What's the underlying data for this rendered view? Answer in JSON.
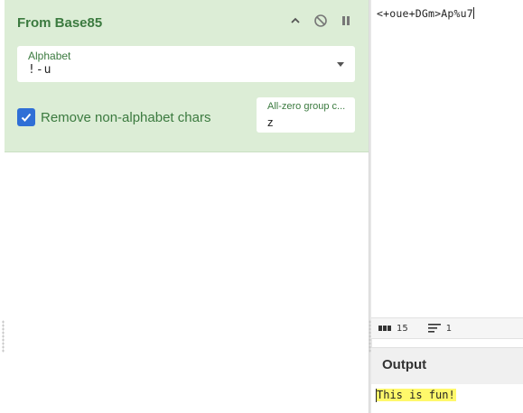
{
  "operation": {
    "title": "From Base85",
    "controls": {
      "collapse_icon": "chevron-up-icon",
      "disable_icon": "disable-icon",
      "pause_icon": "pause-icon"
    },
    "alphabet": {
      "label": "Alphabet",
      "value": "!-u"
    },
    "remove_non_alphabet": {
      "label": "Remove non-alphabet chars",
      "checked": true
    },
    "all_zero": {
      "label": "All-zero group c...",
      "value": "z"
    }
  },
  "input": {
    "text": "<+oue+DGm>Ap%u7"
  },
  "status": {
    "length_icon": "abc-icon",
    "length": "15",
    "lines_icon": "lines-icon",
    "lines": "1"
  },
  "output": {
    "title": "Output",
    "text": "This is fun!"
  },
  "colors": {
    "card_bg": "#dcedd6",
    "accent_green": "#3b7a3f",
    "checkbox_blue": "#2f6fd6",
    "highlight": "#fff86b"
  }
}
